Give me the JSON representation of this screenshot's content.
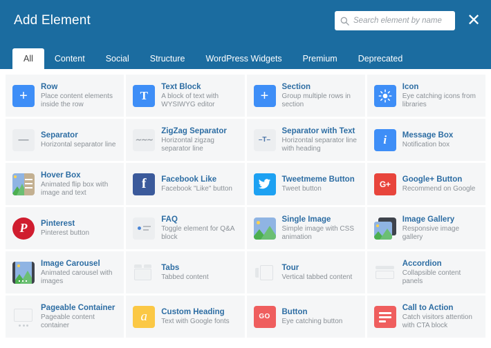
{
  "header": {
    "title": "Add Element",
    "search_placeholder": "Search element by name",
    "search_value": "",
    "search_icon": "search-icon",
    "close_icon": "close-icon",
    "bg_color": "#1b6ca0"
  },
  "tabs": [
    {
      "label": "All",
      "active": true
    },
    {
      "label": "Content",
      "active": false
    },
    {
      "label": "Social",
      "active": false
    },
    {
      "label": "Structure",
      "active": false
    },
    {
      "label": "WordPress Widgets",
      "active": false
    },
    {
      "label": "Premium",
      "active": false
    },
    {
      "label": "Deprecated",
      "active": false
    }
  ],
  "elements": [
    {
      "title": "Row",
      "desc": "Place content elements inside the row",
      "icon": "plus-icon",
      "icon_color": "#3e8ef7"
    },
    {
      "title": "Text Block",
      "desc": "A block of text with WYSIWYG editor",
      "icon": "text-t-icon",
      "icon_color": "#3e8ef7"
    },
    {
      "title": "Section",
      "desc": "Group multiple rows in section",
      "icon": "plus-icon",
      "icon_color": "#3e434c"
    },
    {
      "title": "Icon",
      "desc": "Eye catching icons from libraries",
      "icon": "sun-icon",
      "icon_color": "#3e8ef7"
    },
    {
      "title": "Separator",
      "desc": "Horizontal separator line",
      "icon": "horizontal-line-icon",
      "icon_color": "#eceef0"
    },
    {
      "title": "ZigZag Separator",
      "desc": "Horizontal zigzag separator line",
      "icon": "zigzag-icon",
      "icon_color": "#eceef0"
    },
    {
      "title": "Separator with Text",
      "desc": "Horizontal separator line with heading",
      "icon": "separator-text-icon",
      "icon_color": "#eceef0"
    },
    {
      "title": "Message Box",
      "desc": "Notification box",
      "icon": "info-circle-icon",
      "icon_color": "#3e8ef7"
    },
    {
      "title": "Hover Box",
      "desc": "Animated flip box with image and text",
      "icon": "image-text-icon",
      "icon_color": "#c3b091"
    },
    {
      "title": "Facebook Like",
      "desc": "Facebook \"Like\" button",
      "icon": "facebook-icon",
      "icon_color": "#3b5a9b"
    },
    {
      "title": "Tweetmeme Button",
      "desc": "Tweet button",
      "icon": "twitter-icon",
      "icon_color": "#1da1f2"
    },
    {
      "title": "Google+ Button",
      "desc": "Recommend on Google",
      "icon": "google-plus-icon",
      "icon_color": "#e8453c"
    },
    {
      "title": "Pinterest",
      "desc": "Pinterest button",
      "icon": "pinterest-icon",
      "icon_color": "#d01d2f"
    },
    {
      "title": "FAQ",
      "desc": "Toggle element for Q&A block",
      "icon": "list-toggle-icon",
      "icon_color": "#eceef0"
    },
    {
      "title": "Single Image",
      "desc": "Simple image with CSS animation",
      "icon": "image-icon",
      "icon_color": "#8fb4e3"
    },
    {
      "title": "Image Gallery",
      "desc": "Responsive image gallery",
      "icon": "image-stack-icon",
      "icon_color": "#3e434c"
    },
    {
      "title": "Image Carousel",
      "desc": "Animated carousel with images",
      "icon": "image-carousel-icon",
      "icon_color": "#8fb4e3"
    },
    {
      "title": "Tabs",
      "desc": "Tabbed content",
      "icon": "tabs-icon",
      "icon_color": "#eceef0"
    },
    {
      "title": "Tour",
      "desc": "Vertical tabbed content",
      "icon": "tour-icon",
      "icon_color": "#eceef0"
    },
    {
      "title": "Accordion",
      "desc": "Collapsible content panels",
      "icon": "accordion-icon",
      "icon_color": "#eceef0"
    },
    {
      "title": "Pageable Container",
      "desc": "Pageable content container",
      "icon": "pageable-icon",
      "icon_color": "#eceef0"
    },
    {
      "title": "Custom Heading",
      "desc": "Text with Google fonts",
      "icon": "font-a-icon",
      "icon_color": "#fbc845"
    },
    {
      "title": "Button",
      "desc": "Eye catching button",
      "icon": "go-button-icon",
      "icon_color": "#ef5e5e"
    },
    {
      "title": "Call to Action",
      "desc": "Catch visitors attention with CTA block",
      "icon": "cta-lines-icon",
      "icon_color": "#ef5e5e"
    }
  ]
}
